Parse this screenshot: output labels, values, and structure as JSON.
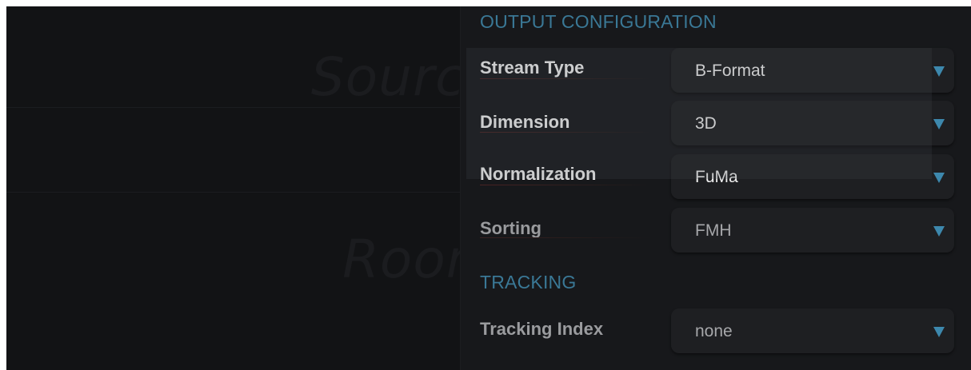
{
  "background": {
    "labels": [
      "Source",
      "Room"
    ]
  },
  "output_configuration": {
    "title": "OUTPUT CONFIGURATION",
    "rows": [
      {
        "label": "Stream Type",
        "value": "B-Format"
      },
      {
        "label": "Dimension",
        "value": "3D"
      },
      {
        "label": "Normalization",
        "value": "FuMa"
      },
      {
        "label": "Sorting",
        "value": "FMH"
      }
    ]
  },
  "tracking": {
    "title": "TRACKING",
    "rows": [
      {
        "label": "Tracking Index",
        "value": "none"
      }
    ]
  },
  "colors": {
    "accent": "#3a7896",
    "caret": "#3d88ad",
    "panel_bg": "#17181b",
    "dropdown_bg": "#1e1f22"
  },
  "icons": {
    "dropdown_caret": "caret-down-icon"
  }
}
